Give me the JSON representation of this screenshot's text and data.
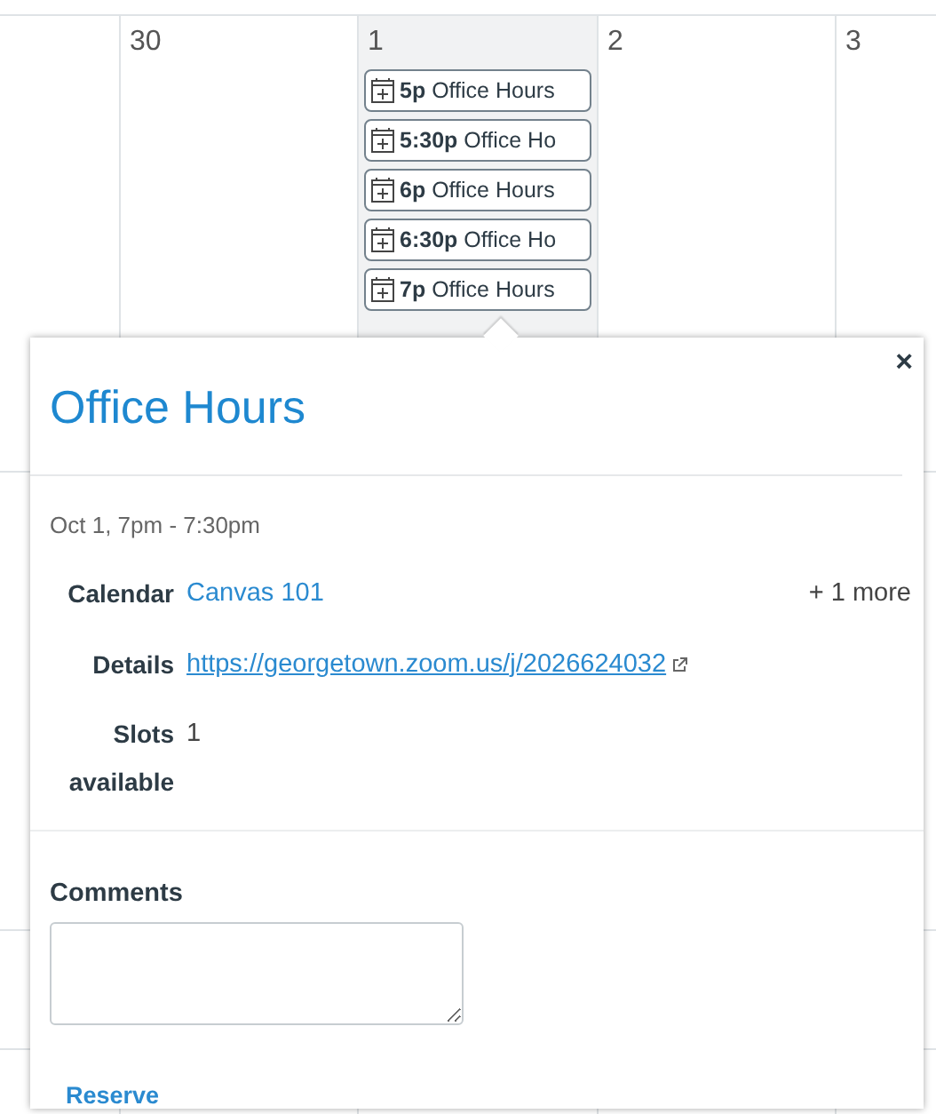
{
  "calendar": {
    "days": [
      {
        "label": "30",
        "today": false
      },
      {
        "label": "1",
        "today": true,
        "events": [
          {
            "time": "5p",
            "title": "Office Hours"
          },
          {
            "time": "5:30p",
            "title": "Office Ho"
          },
          {
            "time": "6p",
            "title": "Office Hours"
          },
          {
            "time": "6:30p",
            "title": "Office Ho"
          },
          {
            "time": "7p",
            "title": "Office Hours"
          }
        ]
      },
      {
        "label": "2",
        "today": false
      },
      {
        "label": "3",
        "today": false
      }
    ]
  },
  "popup": {
    "title": "Office Hours",
    "close": "×",
    "when": "Oct 1, 7pm - 7:30pm",
    "fields": [
      {
        "kind": "link",
        "label": "Calendar",
        "value": "Canvas 101",
        "extra": "+ 1 more"
      },
      {
        "kind": "url",
        "label": "Details",
        "value": "https://georgetown.zoom.us/j/2026624032"
      },
      {
        "kind": "text",
        "label": "Slots available",
        "value": "1"
      }
    ],
    "comments_label": "Comments",
    "reserve": "Reserve"
  }
}
